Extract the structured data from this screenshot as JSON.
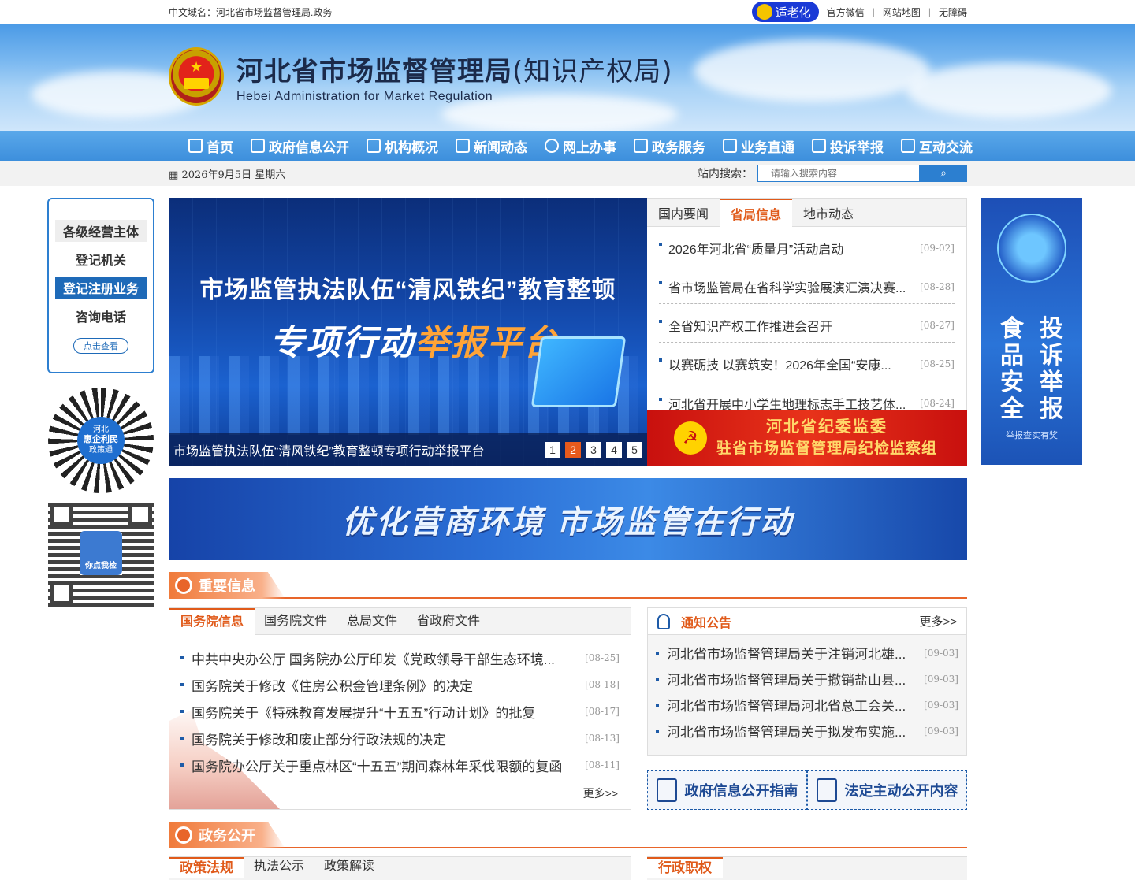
{
  "topbar": {
    "domain_label": "中文域名：河北省市场监督管理局.政务",
    "elder_mode": "适老化",
    "links": [
      "官方微信",
      "网站地图",
      "无障碍"
    ]
  },
  "header": {
    "title": "河北省市场监督管理局",
    "title_sub": "(知识产权局)",
    "title_en": "Hebei Administration for Market Regulation"
  },
  "nav": {
    "items": [
      "首页",
      "政府信息公开",
      "机构概况",
      "新闻动态",
      "网上办事",
      "政务服务",
      "业务直通",
      "投诉举报",
      "互动交流"
    ]
  },
  "subbar": {
    "date": "2026年9月5日 星期六",
    "search_label": "站内搜索：",
    "search_placeholder": "请输入搜索内容"
  },
  "left_box": {
    "items": [
      "各级经营主体",
      "登记机关",
      "登记注册业务",
      "咨询电话"
    ],
    "button": "点击查看"
  },
  "qr": {
    "qr1_text": [
      "河北",
      "惠企利民",
      "政策通"
    ],
    "qr2_text": "你点我检"
  },
  "right_ad": {
    "col1": "食品安全",
    "col2": "投诉举报",
    "footer": "举报查实有奖"
  },
  "carousel": {
    "headline": "市场监管执法队伍“清风铁纪”教育整顿",
    "subline_a": "专项行动",
    "subline_b": "举报平台",
    "caption": "市场监管执法队伍“清风铁纪”教育整顿专项行动举报平台",
    "dots": [
      "1",
      "2",
      "3",
      "4",
      "5"
    ],
    "active_dot": 2
  },
  "news": {
    "tabs": [
      "国内要闻",
      "省局信息",
      "地市动态"
    ],
    "items": [
      {
        "title": "2026年河北省“质量月”活动启动",
        "date": "[09-02]"
      },
      {
        "title": "省市场监管局在省科学实验展演汇演决赛...",
        "date": "[08-28]"
      },
      {
        "title": "全省知识产权工作推进会召开",
        "date": "[08-27]"
      },
      {
        "title": "以赛砺技 以赛筑安！2026年全国“安康...",
        "date": "[08-25]"
      },
      {
        "title": "河北省开展中小学生地理标志手工技艺体...",
        "date": "[08-24]"
      }
    ]
  },
  "party_banner": {
    "line1": "河北省纪委监委",
    "line2": "驻省市场监督管理局纪检监察组"
  },
  "wide_banner": {
    "title": "优化营商环境  市场监管在行动"
  },
  "sections": {
    "important": "重要信息",
    "gov_open": "政务公开"
  },
  "state_council": {
    "tabs": [
      "国务院信息",
      "国务院文件",
      "总局文件",
      "省政府文件"
    ],
    "items": [
      {
        "title": "中共中央办公厅 国务院办公厅印发《党政领导干部生态环境...",
        "date": "[08-25]"
      },
      {
        "title": "国务院关于修改《住房公积金管理条例》的决定",
        "date": "[08-18]"
      },
      {
        "title": "国务院关于《特殊教育发展提升“十五五”行动计划》的批复",
        "date": "[08-17]"
      },
      {
        "title": "国务院关于修改和废止部分行政法规的决定",
        "date": "[08-13]"
      },
      {
        "title": "国务院办公厅关于重点林区“十五五”期间森林年采伐限额的复函",
        "date": "[08-11]"
      }
    ],
    "more": "更多>>"
  },
  "notice": {
    "title": "通知公告",
    "more": "更多>>",
    "items": [
      {
        "title": "河北省市场监督管理局关于注销河北雄...",
        "date": "[09-03]"
      },
      {
        "title": "河北省市场监督管理局关于撤销盐山县...",
        "date": "[09-03]"
      },
      {
        "title": "河北省市场监督管理局河北省总工会关...",
        "date": "[09-03]"
      },
      {
        "title": "河北省市场监督管理局关于拟发布实施...",
        "date": "[09-03]"
      }
    ]
  },
  "guides": [
    "政府信息公开指南",
    "法定主动公开内容"
  ],
  "bottom_tabs": {
    "left": [
      "政策法规",
      "执法公示",
      "政策解读"
    ],
    "right": [
      "行政职权"
    ]
  }
}
